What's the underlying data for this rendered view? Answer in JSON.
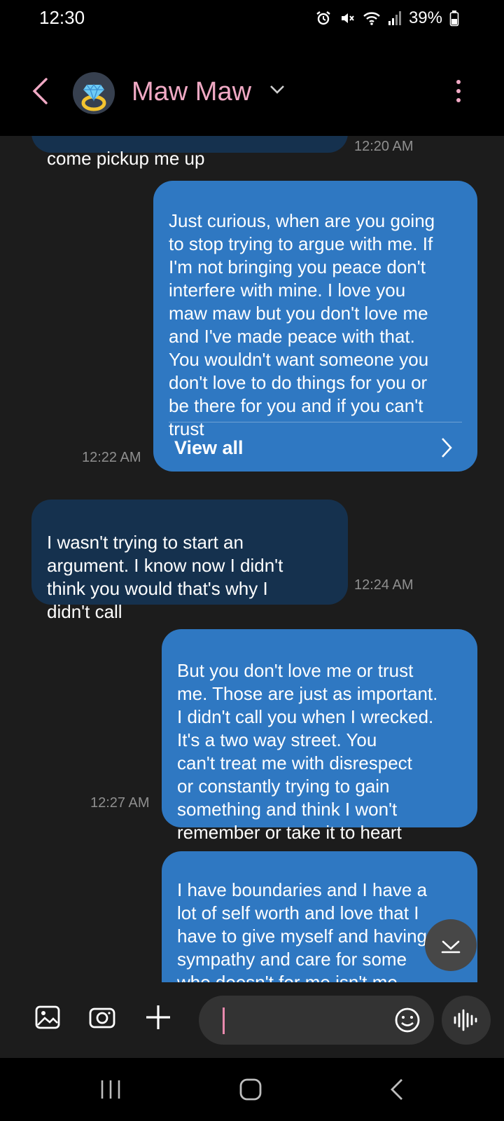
{
  "status_bar": {
    "time": "12:30",
    "battery": "39%"
  },
  "header": {
    "contact_name": "Maw Maw",
    "icons": {
      "back": "chevron-left-icon",
      "dropdown": "chevron-down-icon",
      "more": "more-vertical-icon"
    },
    "name_color": "#f0a9c4"
  },
  "messages": [
    {
      "direction": "incoming",
      "text": "come pickup me up",
      "time": "12:20 AM"
    },
    {
      "direction": "outgoing",
      "text": "Just curious, when are you going\nto stop trying to argue with me. If\nI'm not bringing you peace don't\ninterfere with mine. I love you\nmaw maw but you don't love me\nand I've made peace with that.\nYou wouldn't want someone you\ndon't love to  do things for you or\nbe there for you and if you can't\ntrust",
      "time": "12:22 AM",
      "action": "View all"
    },
    {
      "direction": "incoming",
      "text": "I wasn't trying to start an\nargument. I know now I didn't\nthink you would that's why I\ndidn't call",
      "time": "12:24 AM"
    },
    {
      "direction": "outgoing",
      "text": "But you don't love me or trust\nme. Those are just as important.\nI didn't call you when I wrecked.\nIt's a two way street. You\ncan't treat me with disrespect\nor constantly trying to gain\nsomething and think I won't\nremember or take it to heart",
      "time": "12:27 AM"
    },
    {
      "direction": "outgoing",
      "text": "I have boundaries and I have a\nlot of self worth and love that I\nhave to give myself and having\nsympathy and care for some\nwho doesn't for me isn't me\nbeing disrespectful. It's me\nma\nI D\nhow you are to me. That's valid"
    }
  ],
  "composer": {
    "icons": [
      "gallery-icon",
      "camera-icon",
      "plus-icon",
      "emoji-icon",
      "voice-wave-icon"
    ],
    "input_value": ""
  },
  "colors": {
    "outgoing_bubble": "#2f78c2",
    "incoming_bubble": "#15314e",
    "background": "#1c1c1c"
  }
}
